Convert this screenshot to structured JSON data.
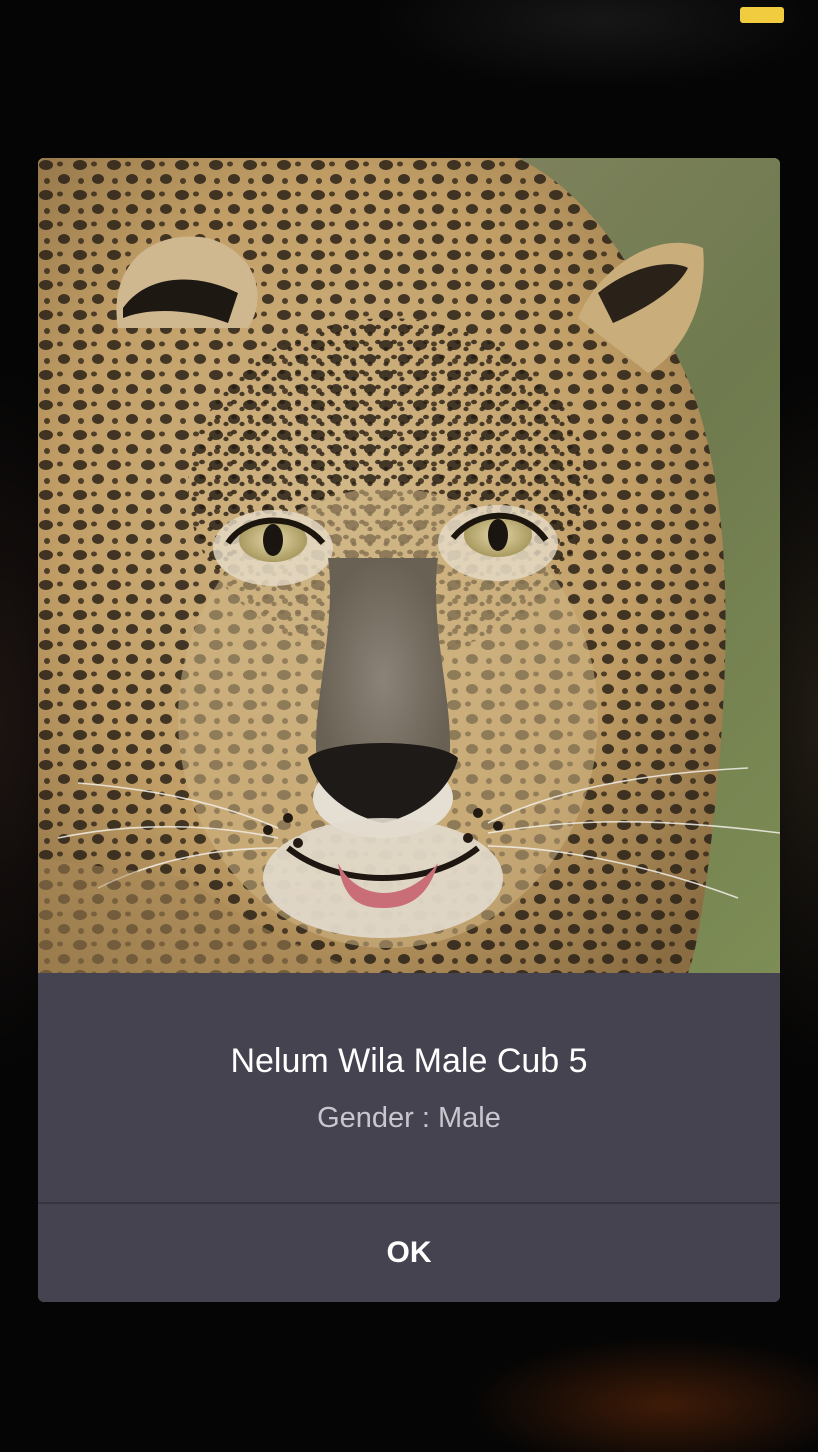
{
  "dialog": {
    "photo_subject": "leopard",
    "title": "Nelum Wila Male Cub 5",
    "gender_line": "Gender : Male",
    "ok_label": "OK"
  },
  "status_bar": {
    "battery_icon": "battery-icon",
    "battery_color": "#f2cc3f"
  },
  "colors": {
    "dialog_background": "#45434f",
    "title_text": "#ffffff",
    "subtitle_text": "#c8c6cf",
    "page_background": "#050505"
  }
}
